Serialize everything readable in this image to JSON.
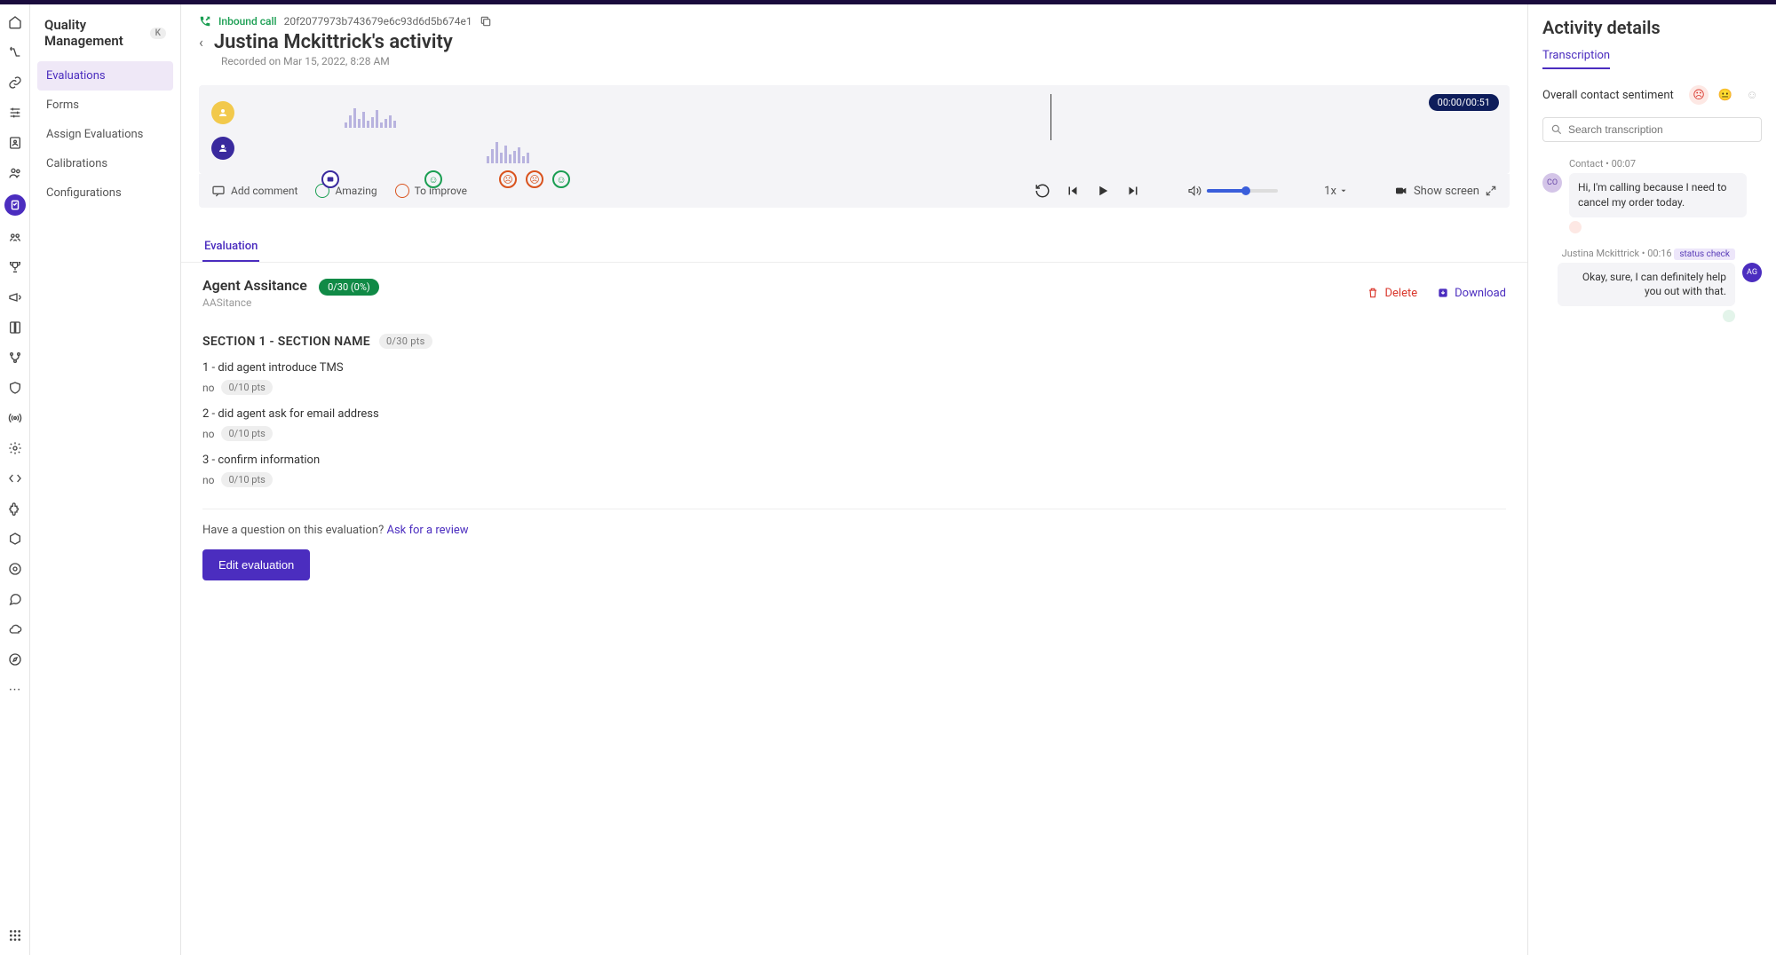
{
  "subnav": {
    "title": "Quality Management",
    "badge": "K",
    "items": [
      "Evaluations",
      "Forms",
      "Assign Evaluations",
      "Calibrations",
      "Configurations"
    ]
  },
  "header": {
    "call_type": "Inbound call",
    "call_id": "20f2077973b743679e6c93d6d5b674e1",
    "title": "Justina Mckittrick's activity",
    "recorded": "Recorded on Mar 15, 2022, 8:28 AM"
  },
  "player": {
    "time": "00:00/00:51",
    "add_comment": "Add comment",
    "amazing": "Amazing",
    "to_improve": "To improve",
    "speed": "1x",
    "show_screen": "Show screen"
  },
  "tabs": {
    "evaluation": "Evaluation"
  },
  "evaluation": {
    "name": "Agent Assitance",
    "score": "0/30 (0%)",
    "sub": "AASitance",
    "delete": "Delete",
    "download": "Download",
    "section_title": "SECTION 1 - SECTION NAME",
    "section_pts": "0/30 pts",
    "questions": [
      {
        "text": "1 - did agent introduce TMS",
        "answer": "no",
        "pts": "0/10 pts"
      },
      {
        "text": "2 - did agent ask for email address",
        "answer": "no",
        "pts": "0/10 pts"
      },
      {
        "text": "3 - confirm information",
        "answer": "no",
        "pts": "0/10 pts"
      }
    ],
    "footer_q": "Have a question on this evaluation? ",
    "footer_link": "Ask for a review",
    "edit_btn": "Edit evaluation"
  },
  "right": {
    "title": "Activity details",
    "tab": "Transcription",
    "sentiment_label": "Overall contact sentiment",
    "search_placeholder": "Search transcription",
    "msgs": [
      {
        "meta": "Contact • 00:07",
        "avatar": "CO",
        "side": "left",
        "text": "Hi, I'm calling because I need to cancel my order today.",
        "senti": "neg"
      },
      {
        "meta": "Justina Mckittrick • 00:16",
        "tag": "status check",
        "avatar": "AG",
        "side": "right",
        "text": "Okay, sure, I can definitely help you out with that.",
        "senti": "pos"
      }
    ]
  }
}
